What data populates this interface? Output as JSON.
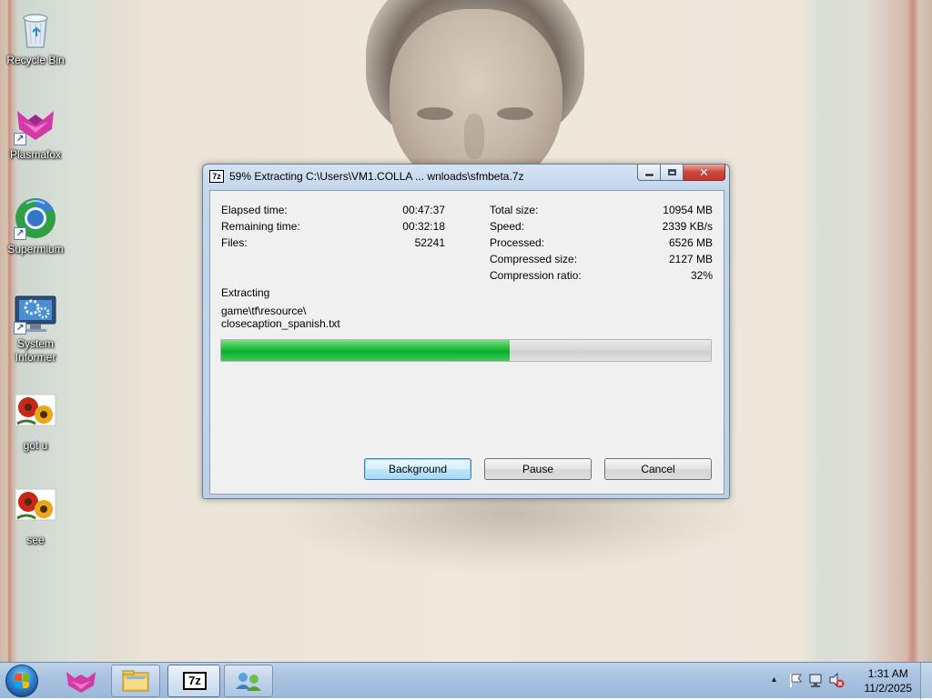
{
  "desktop": {
    "icons": [
      {
        "label": "Recycle Bin"
      },
      {
        "label": "Plasmafox"
      },
      {
        "label": "Supermium"
      },
      {
        "label": "System Informer"
      },
      {
        "label": "got u"
      },
      {
        "label": "see"
      }
    ]
  },
  "dialog": {
    "title_icon": "7z",
    "title": "59% Extracting C:\\Users\\VM1.COLLA ... wnloads\\sfmbeta.7z",
    "stats_left": [
      {
        "label": "Elapsed time:",
        "value": "00:47:37"
      },
      {
        "label": "Remaining time:",
        "value": "00:32:18"
      },
      {
        "label": "Files:",
        "value": "52241"
      }
    ],
    "stats_right": [
      {
        "label": "Total size:",
        "value": "10954 MB"
      },
      {
        "label": "Speed:",
        "value": "2339 KB/s"
      },
      {
        "label": "Processed:",
        "value": "6526 MB"
      },
      {
        "label": "Compressed size:",
        "value": "2127 MB"
      },
      {
        "label": "Compression ratio:",
        "value": "32%"
      }
    ],
    "status_label": "Extracting",
    "current_file_line1": "game\\tf\\resource\\",
    "current_file_line2": "closecaption_spanish.txt",
    "progress_fraction": 0.59,
    "buttons": {
      "background": "Background",
      "pause": "Pause",
      "cancel": "Cancel"
    },
    "close_glyph": "✕"
  },
  "taskbar": {
    "pinned": [
      "windows-start-icon",
      "plasmafox-icon",
      "file-explorer-icon",
      "7zip-icon",
      "network-app-icon"
    ],
    "seven_zip_label": "7z",
    "clock_time": "1:31 AM",
    "clock_date": "11/2/2025"
  },
  "colors": {
    "progress_green": "#09b02c",
    "titlebar_blue": "#c2d6ec",
    "close_red": "#c9473b"
  }
}
